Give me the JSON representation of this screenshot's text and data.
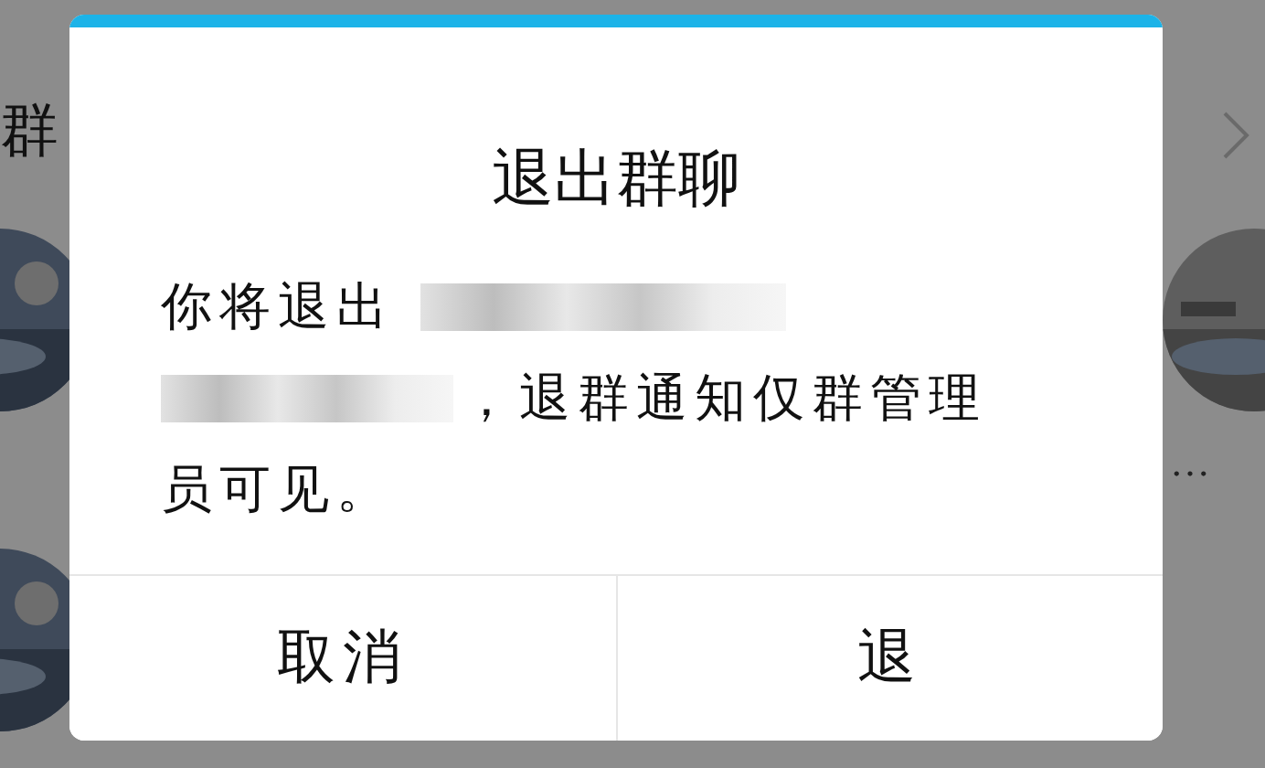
{
  "background": {
    "header_text": "群",
    "trailing_text": "…"
  },
  "dialog": {
    "title": "退出群聊",
    "lines": [
      [
        {
          "kind": "text",
          "text": "你将退出"
        },
        {
          "kind": "redacted"
        }
      ],
      [
        {
          "kind": "redacted"
        },
        {
          "kind": "text",
          "text": "，退群通知仅群管理"
        }
      ],
      [
        {
          "kind": "text",
          "text": "员可见。"
        }
      ]
    ],
    "buttons": [
      {
        "label": "取消"
      },
      {
        "label": "退"
      }
    ]
  }
}
